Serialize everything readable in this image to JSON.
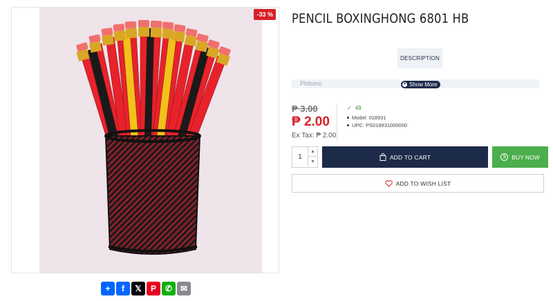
{
  "product": {
    "title": "PENCIL BOXINGHONG 6801 HB",
    "discount_badge": "-33 %",
    "old_price": "₱ 3.00",
    "new_price": "₱ 2.00",
    "ex_tax": "Ex Tax: ₱ 2.00",
    "stock_count": "49",
    "model": "Model: 018931",
    "upc": "UPC: PS018931000000"
  },
  "tabs": {
    "description_label": "DESCRIPTION"
  },
  "description": {
    "preview_text": "Philsino",
    "show_more_label": "Show More"
  },
  "cart": {
    "quantity": "1",
    "add_to_cart_label": "ADD TO CART",
    "buy_now_label": "BUY NOW",
    "wishlist_label": "ADD TO WISH LIST"
  },
  "share": {
    "icons": [
      "share-plus-icon",
      "facebook-icon",
      "x-icon",
      "pinterest-icon",
      "whatsapp-icon",
      "email-icon"
    ]
  },
  "colors": {
    "brand_navy": "#1d2b4a",
    "sale_red": "#d62027",
    "buy_green": "#4cae4c",
    "stock_green": "#3a8f3a"
  }
}
